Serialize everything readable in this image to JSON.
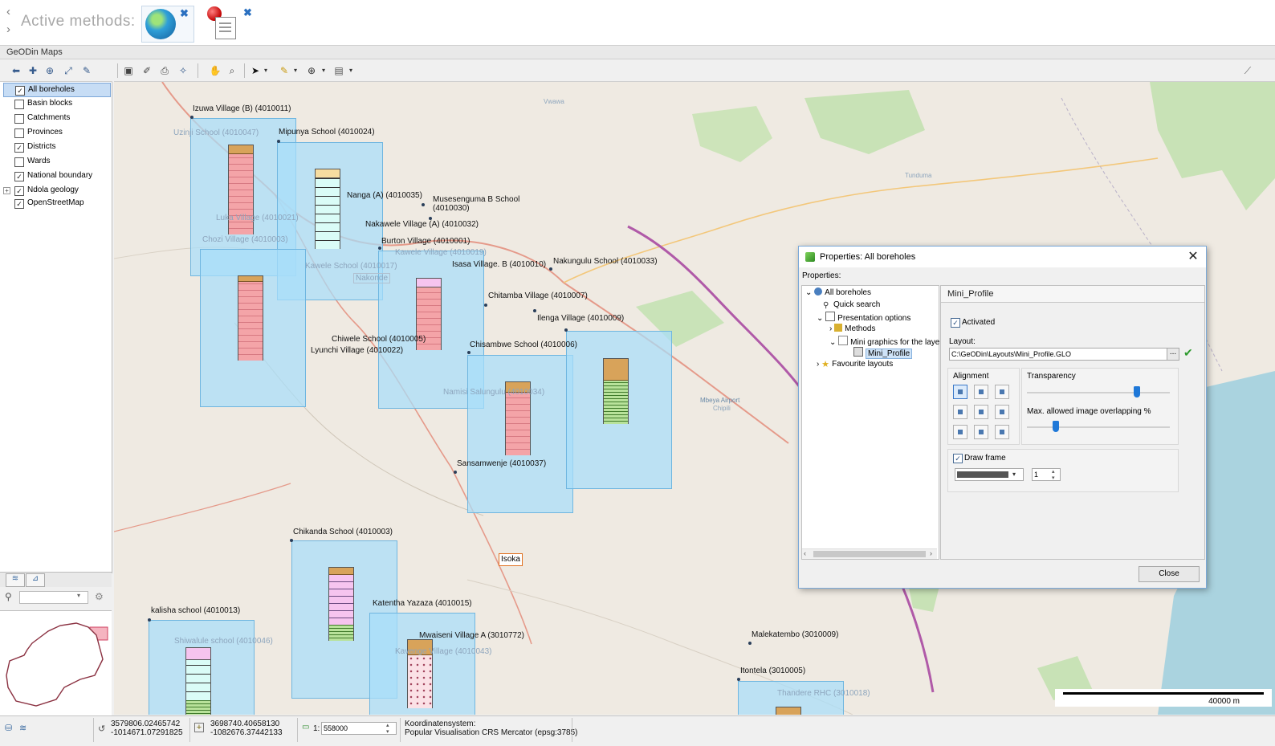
{
  "active_methods": {
    "title": "Active methods:",
    "methods": [
      {
        "icon": "globe-icon",
        "close": "✖"
      },
      {
        "icon": "pin-note-icon",
        "close": "✖"
      }
    ]
  },
  "app": {
    "title": "GeODin Maps"
  },
  "layers": {
    "items": [
      {
        "label": "All boreholes",
        "checked": "✓"
      },
      {
        "label": "Basin blocks",
        "checked": ""
      },
      {
        "label": "Catchments",
        "checked": ""
      },
      {
        "label": "Provinces",
        "checked": ""
      },
      {
        "label": "Districts",
        "checked": "✓"
      },
      {
        "label": "Wards",
        "checked": ""
      },
      {
        "label": "National boundary",
        "checked": "✓"
      },
      {
        "label": "Ndola geology",
        "checked": "✓",
        "expand": "+"
      },
      {
        "label": "OpenStreetMap",
        "checked": "✓"
      }
    ]
  },
  "map": {
    "labels": [
      "Izuwa Village (B) (4010011)",
      "Uzinji School (4010047)",
      "Mipunya School (4010024)",
      "Nanga (A) (4010035)",
      "Musesenguma B School (4010030)",
      "Nakawele Village (A) (4010032)",
      "Luka Village (4010021)",
      "Chozi Village (4010003)",
      "Burton Village (4010001)",
      "Kawele Village (4010019)",
      "Isasa Village. B (4010010)",
      "Nakungulu School (4010033)",
      "Kawele School (4010017)",
      "Nakonde",
      "Chitamba Village (4010007)",
      "Ilenga Village (4010009)",
      "Chiwele School (4010005)",
      "Lyunchi Village (4010022)",
      "Chisambwe School (4010006)",
      "Namisi Salungulu (4010034)",
      "Sansamwenje (4010037)",
      "Chikanda School (4010003)",
      "Katentha Yazaza (4010015)",
      "kalisha school (4010013)",
      "Shiwalule school (4010046)",
      "Mwaiseni Village A (3010772)",
      "Kavenge Village (4010043)",
      "Malekatembo (3010009)",
      "Itontela (3010005)",
      "Thandere RHC (3010018)",
      "Vwawa",
      "Tunduma",
      "Isoka",
      "Chipili",
      "Mbeya Airport"
    ],
    "scale_label": "40000 m"
  },
  "status": {
    "coord1_x": "3579806.02465742",
    "coord1_y": "-1014671.07291825",
    "coord2_x": "3698740.40658130",
    "coord2_y": "-1082676.37442133",
    "scale_prefix": "1:",
    "scale_value": "558000",
    "crs_title": "Koordinatensystem:",
    "crs_value": "Popular Visualisation CRS Mercator (epsg:3785)"
  },
  "dialog": {
    "title": "Properties: All boreholes",
    "properties_label": "Properties:",
    "tree": [
      {
        "label": "All boreholes",
        "expand": "⌄"
      },
      {
        "label": "Quick search",
        "expand": ""
      },
      {
        "label": "Presentation options",
        "expand": "⌄"
      },
      {
        "label": "Methods",
        "expand": "›"
      },
      {
        "label": "Mini graphics for the laye",
        "expand": "⌄"
      },
      {
        "label": "Mini_Profile",
        "expand": ""
      },
      {
        "label": "Favourite layouts",
        "expand": "›"
      }
    ],
    "panel_title": "Mini_Profile",
    "activated_label": "Activated",
    "activated_check": "✓",
    "layout_label": "Layout:",
    "layout_value": "C:\\GeODin\\Layouts\\Mini_Profile.GLO",
    "browse": "...",
    "ok_mark": "✔",
    "alignment_label": "Alignment",
    "transparency_label": "Transparency",
    "transparency_value": 0.77,
    "overlap_label": "Max. allowed image overlapping %",
    "overlap_value": 0.2,
    "draw_frame_label": "Draw frame",
    "draw_frame_check": "✓",
    "frame_color": "#555555",
    "frame_width": "1",
    "close_label": "Close"
  }
}
